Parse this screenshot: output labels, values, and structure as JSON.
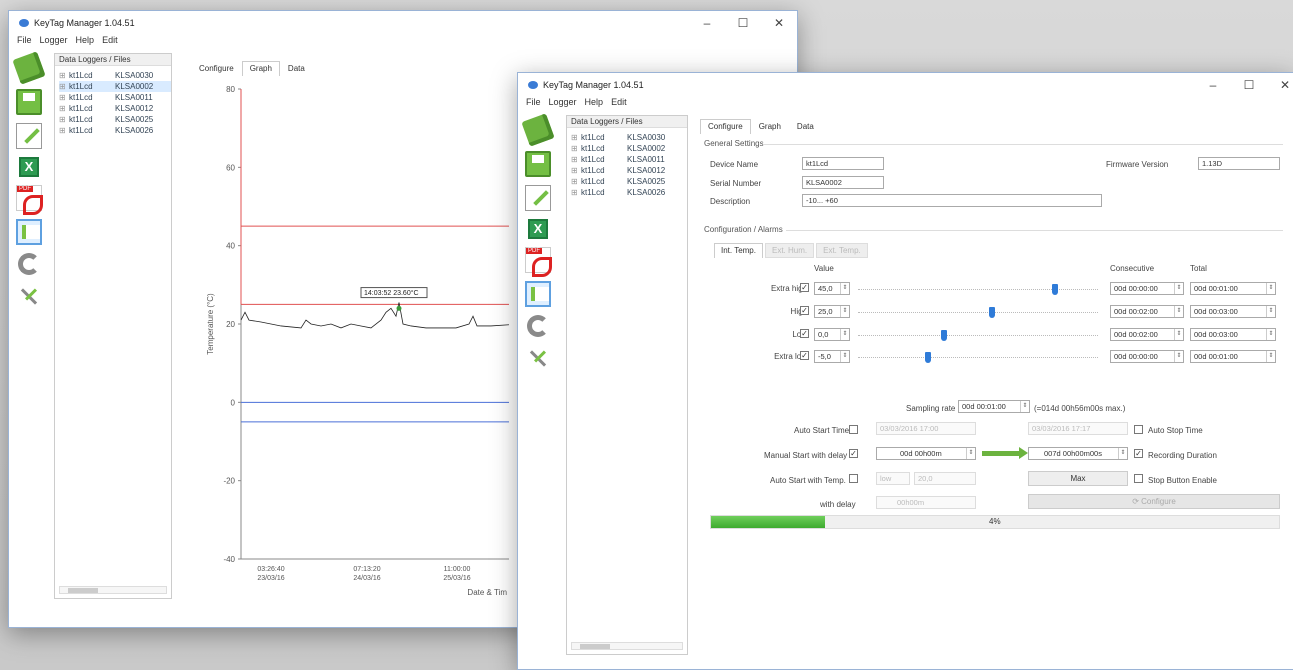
{
  "back_window": {
    "title": "KeyTag Manager 1.04.51",
    "menu": [
      "File",
      "Logger",
      "Help",
      "Edit"
    ],
    "panel_title": "Data Loggers / Files",
    "loggers": [
      {
        "name": "kt1Lcd",
        "serial": "KLSA0030"
      },
      {
        "name": "kt1Lcd",
        "serial": "KLSA0002"
      },
      {
        "name": "kt1Lcd",
        "serial": "KLSA0011"
      },
      {
        "name": "kt1Lcd",
        "serial": "KLSA0012"
      },
      {
        "name": "kt1Lcd",
        "serial": "KLSA0025"
      },
      {
        "name": "kt1Lcd",
        "serial": "KLSA0026"
      }
    ],
    "selected_logger": 1,
    "tabs": [
      "Configure",
      "Graph",
      "Data"
    ],
    "active_tab": 1,
    "graph": {
      "ylabel": "Temperature (°C)",
      "xlabel": "Date & Tim",
      "yticks": [
        "80",
        "60",
        "40",
        "20",
        "0",
        "-20",
        "-40"
      ],
      "xticks": [
        {
          "time": "03:26:40",
          "date": "23/03/16"
        },
        {
          "time": "07:13:20",
          "date": "24/03/16"
        },
        {
          "time": "11:00:00",
          "date": "25/03/16"
        }
      ],
      "tooltip": "14:03:52 23.60°C",
      "line_color": "#222222",
      "high_alarm_color": "#e05050",
      "low_alarm_color": "#4a6fd8"
    }
  },
  "front_window": {
    "title": "KeyTag Manager 1.04.51",
    "menu": [
      "File",
      "Logger",
      "Help",
      "Edit"
    ],
    "panel_title": "Data Loggers / Files",
    "loggers": [
      {
        "name": "kt1Lcd",
        "serial": "KLSA0030"
      },
      {
        "name": "kt1Lcd",
        "serial": "KLSA0002"
      },
      {
        "name": "kt1Lcd",
        "serial": "KLSA0011"
      },
      {
        "name": "kt1Lcd",
        "serial": "KLSA0012"
      },
      {
        "name": "kt1Lcd",
        "serial": "KLSA0025"
      },
      {
        "name": "kt1Lcd",
        "serial": "KLSA0026"
      }
    ],
    "tabs": [
      "Configure",
      "Graph",
      "Data"
    ],
    "active_tab": 0,
    "general": {
      "section": "General Settings",
      "device_name_label": "Device Name",
      "device_name": "kt1Lcd",
      "serial_label": "Serial Number",
      "serial": "KLSA0002",
      "description_label": "Description",
      "description": "-10... +60",
      "firmware_label": "Firmware Version",
      "firmware": "1.13D"
    },
    "alarms": {
      "section": "Configuration / Alarms",
      "subtabs": [
        "Int. Temp.",
        "Ext. Hum.",
        "Ext. Temp."
      ],
      "value_header": "Value",
      "consecutive_header": "Consecutive",
      "total_header": "Total",
      "rows": [
        {
          "label": "Extra high",
          "value": "45,0",
          "level": 0.82,
          "consecutive": "00d 00:00:00",
          "total": "00d 00:01:00"
        },
        {
          "label": "High",
          "value": "25,0",
          "level": 0.56,
          "consecutive": "00d 00:02:00",
          "total": "00d 00:03:00"
        },
        {
          "label": "Low",
          "value": "0,0",
          "level": 0.36,
          "consecutive": "00d 00:02:00",
          "total": "00d 00:03:00"
        },
        {
          "label": "Extra low",
          "value": "-5,0",
          "level": 0.29,
          "consecutive": "00d 00:00:00",
          "total": "00d 00:01:00"
        }
      ]
    },
    "sampling": {
      "label": "Sampling rate",
      "value": "00d 00:01:00",
      "note": "(=014d 00h56m00s max.)"
    },
    "start": {
      "auto_start_time_label": "Auto Start Time",
      "auto_start_time_value": "03/03/2016 17:00",
      "auto_stop_value": "03/03/2016 17:17",
      "auto_stop_label": "Auto Stop Time",
      "manual_delay_label": "Manual Start with delay",
      "manual_delay_value": "00d 00h00m",
      "duration_value": "007d 00h00m00s",
      "recording_duration_label": "Recording Duration",
      "auto_start_temp_label": "Auto Start with Temp.",
      "temp_cond": "low",
      "temp_value": "20,0",
      "max_button": "Max",
      "stop_button_label": "Stop Button Enable",
      "with_delay_label": "with delay",
      "with_delay_value": "00h00m",
      "configure_button": "Configure"
    },
    "progress": {
      "value": 0.4,
      "label": "4%"
    }
  }
}
